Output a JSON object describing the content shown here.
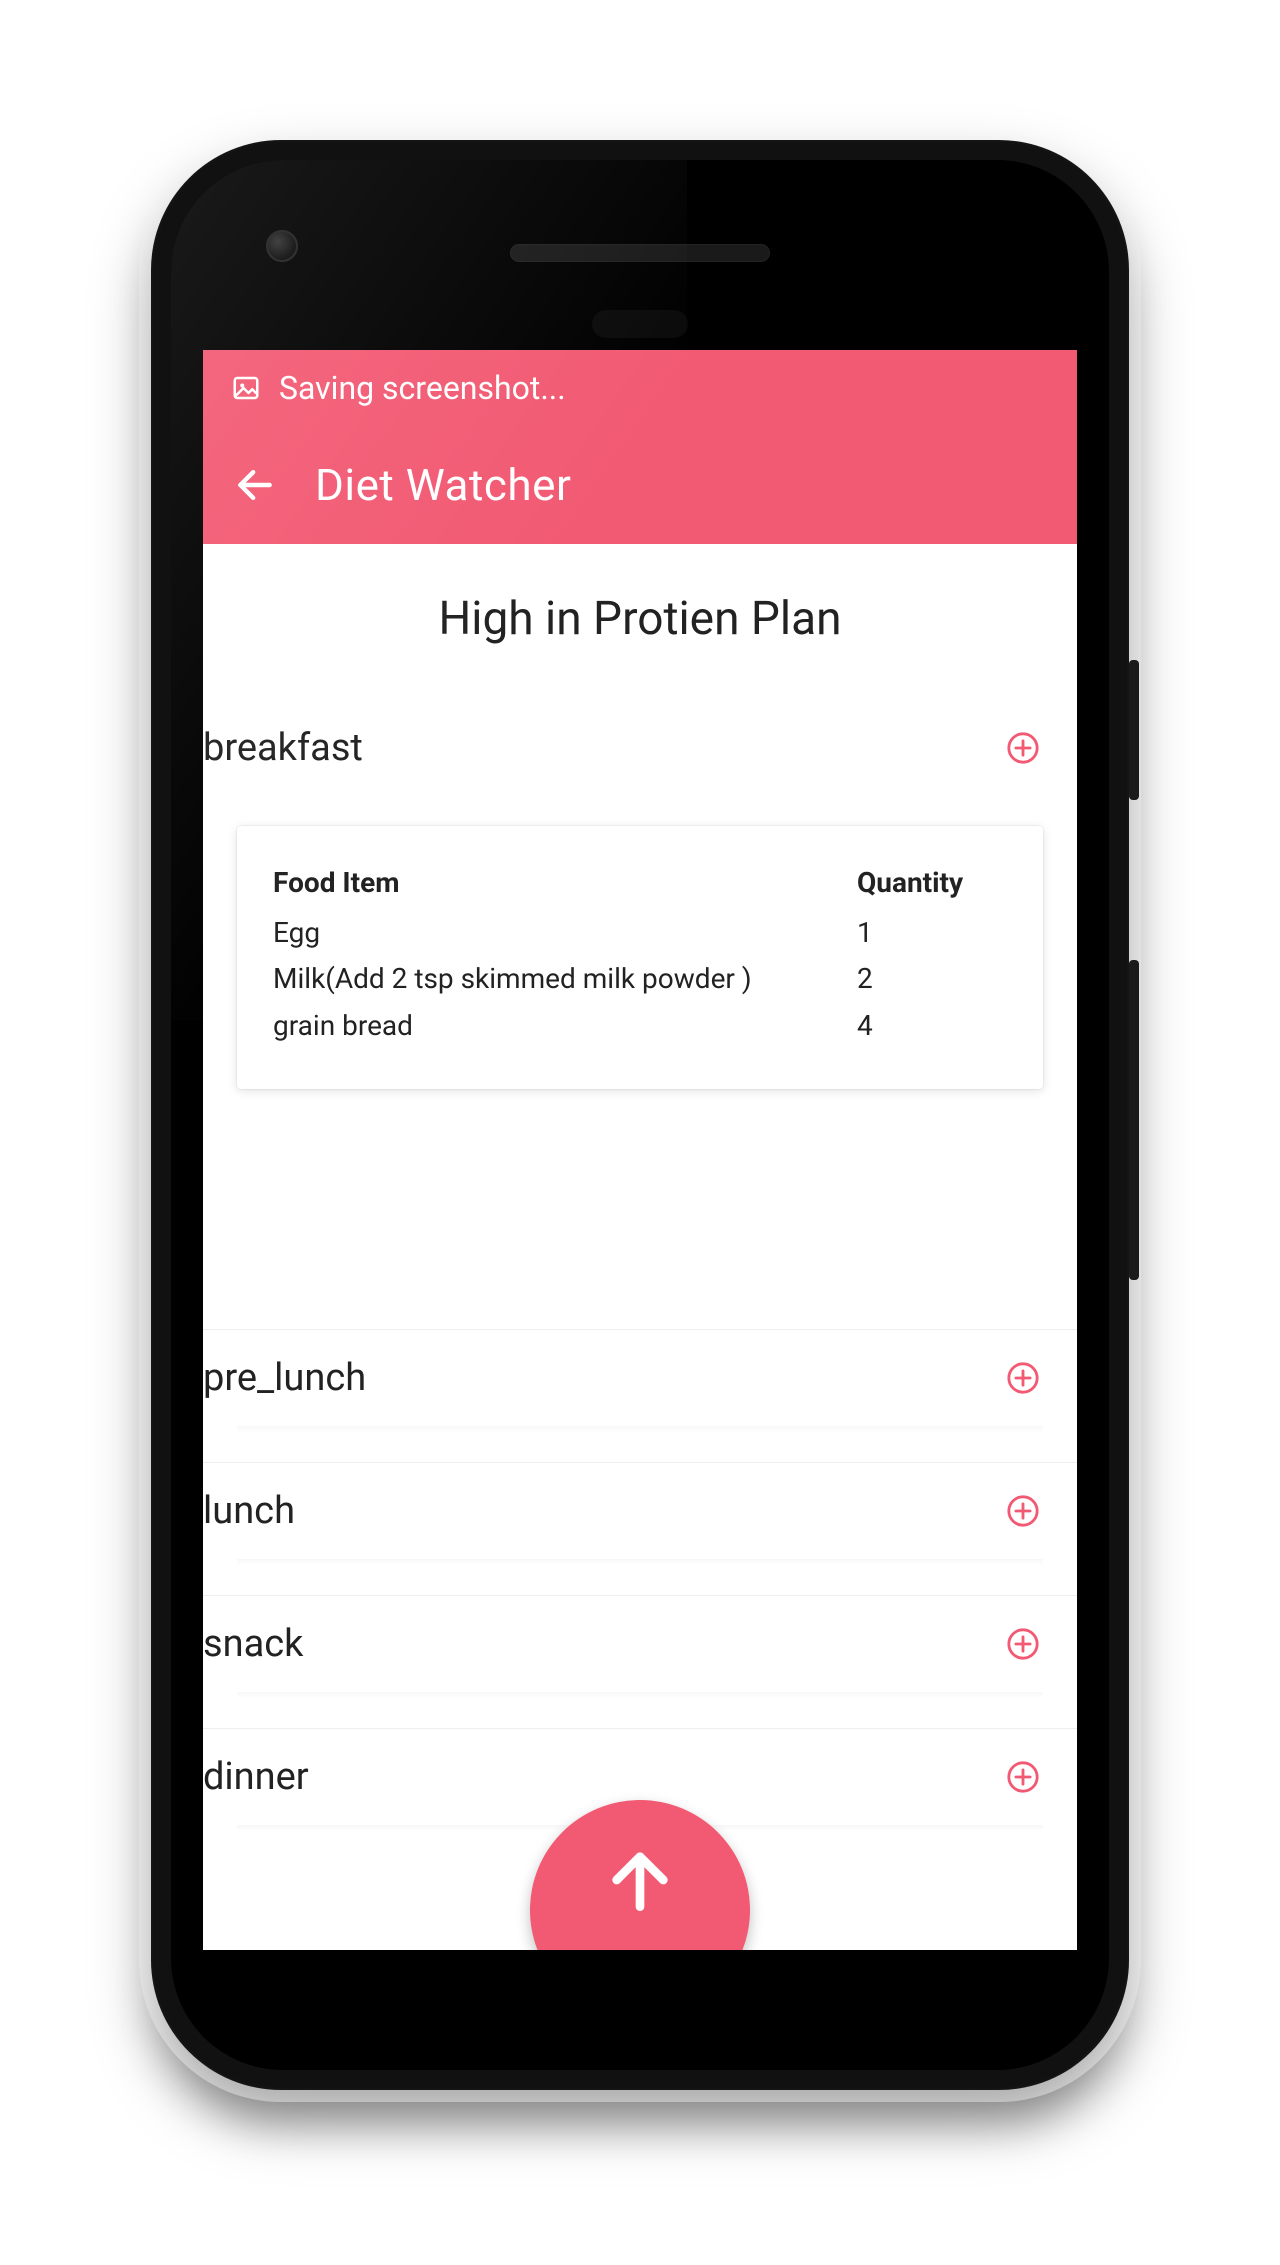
{
  "toast": {
    "text": "Saving screenshot..."
  },
  "appbar": {
    "title": "Diet Watcher"
  },
  "plan": {
    "title": "High in Protien Plan"
  },
  "columns": {
    "food": "Food Item",
    "qty": "Quantity"
  },
  "meals": [
    {
      "key": "breakfast",
      "label": "breakfast",
      "items": [
        {
          "food": "Egg",
          "qty": "1"
        },
        {
          "food": "Milk(Add 2 tsp skimmed milk powder )",
          "qty": "2"
        },
        {
          "food": "grain bread",
          "qty": "4"
        }
      ]
    },
    {
      "key": "pre_lunch",
      "label": "pre_lunch",
      "items": []
    },
    {
      "key": "lunch",
      "label": "lunch",
      "items": []
    },
    {
      "key": "snack",
      "label": "snack",
      "items": []
    },
    {
      "key": "dinner",
      "label": "dinner",
      "items": []
    }
  ],
  "colors": {
    "accent": "#f25a73"
  }
}
